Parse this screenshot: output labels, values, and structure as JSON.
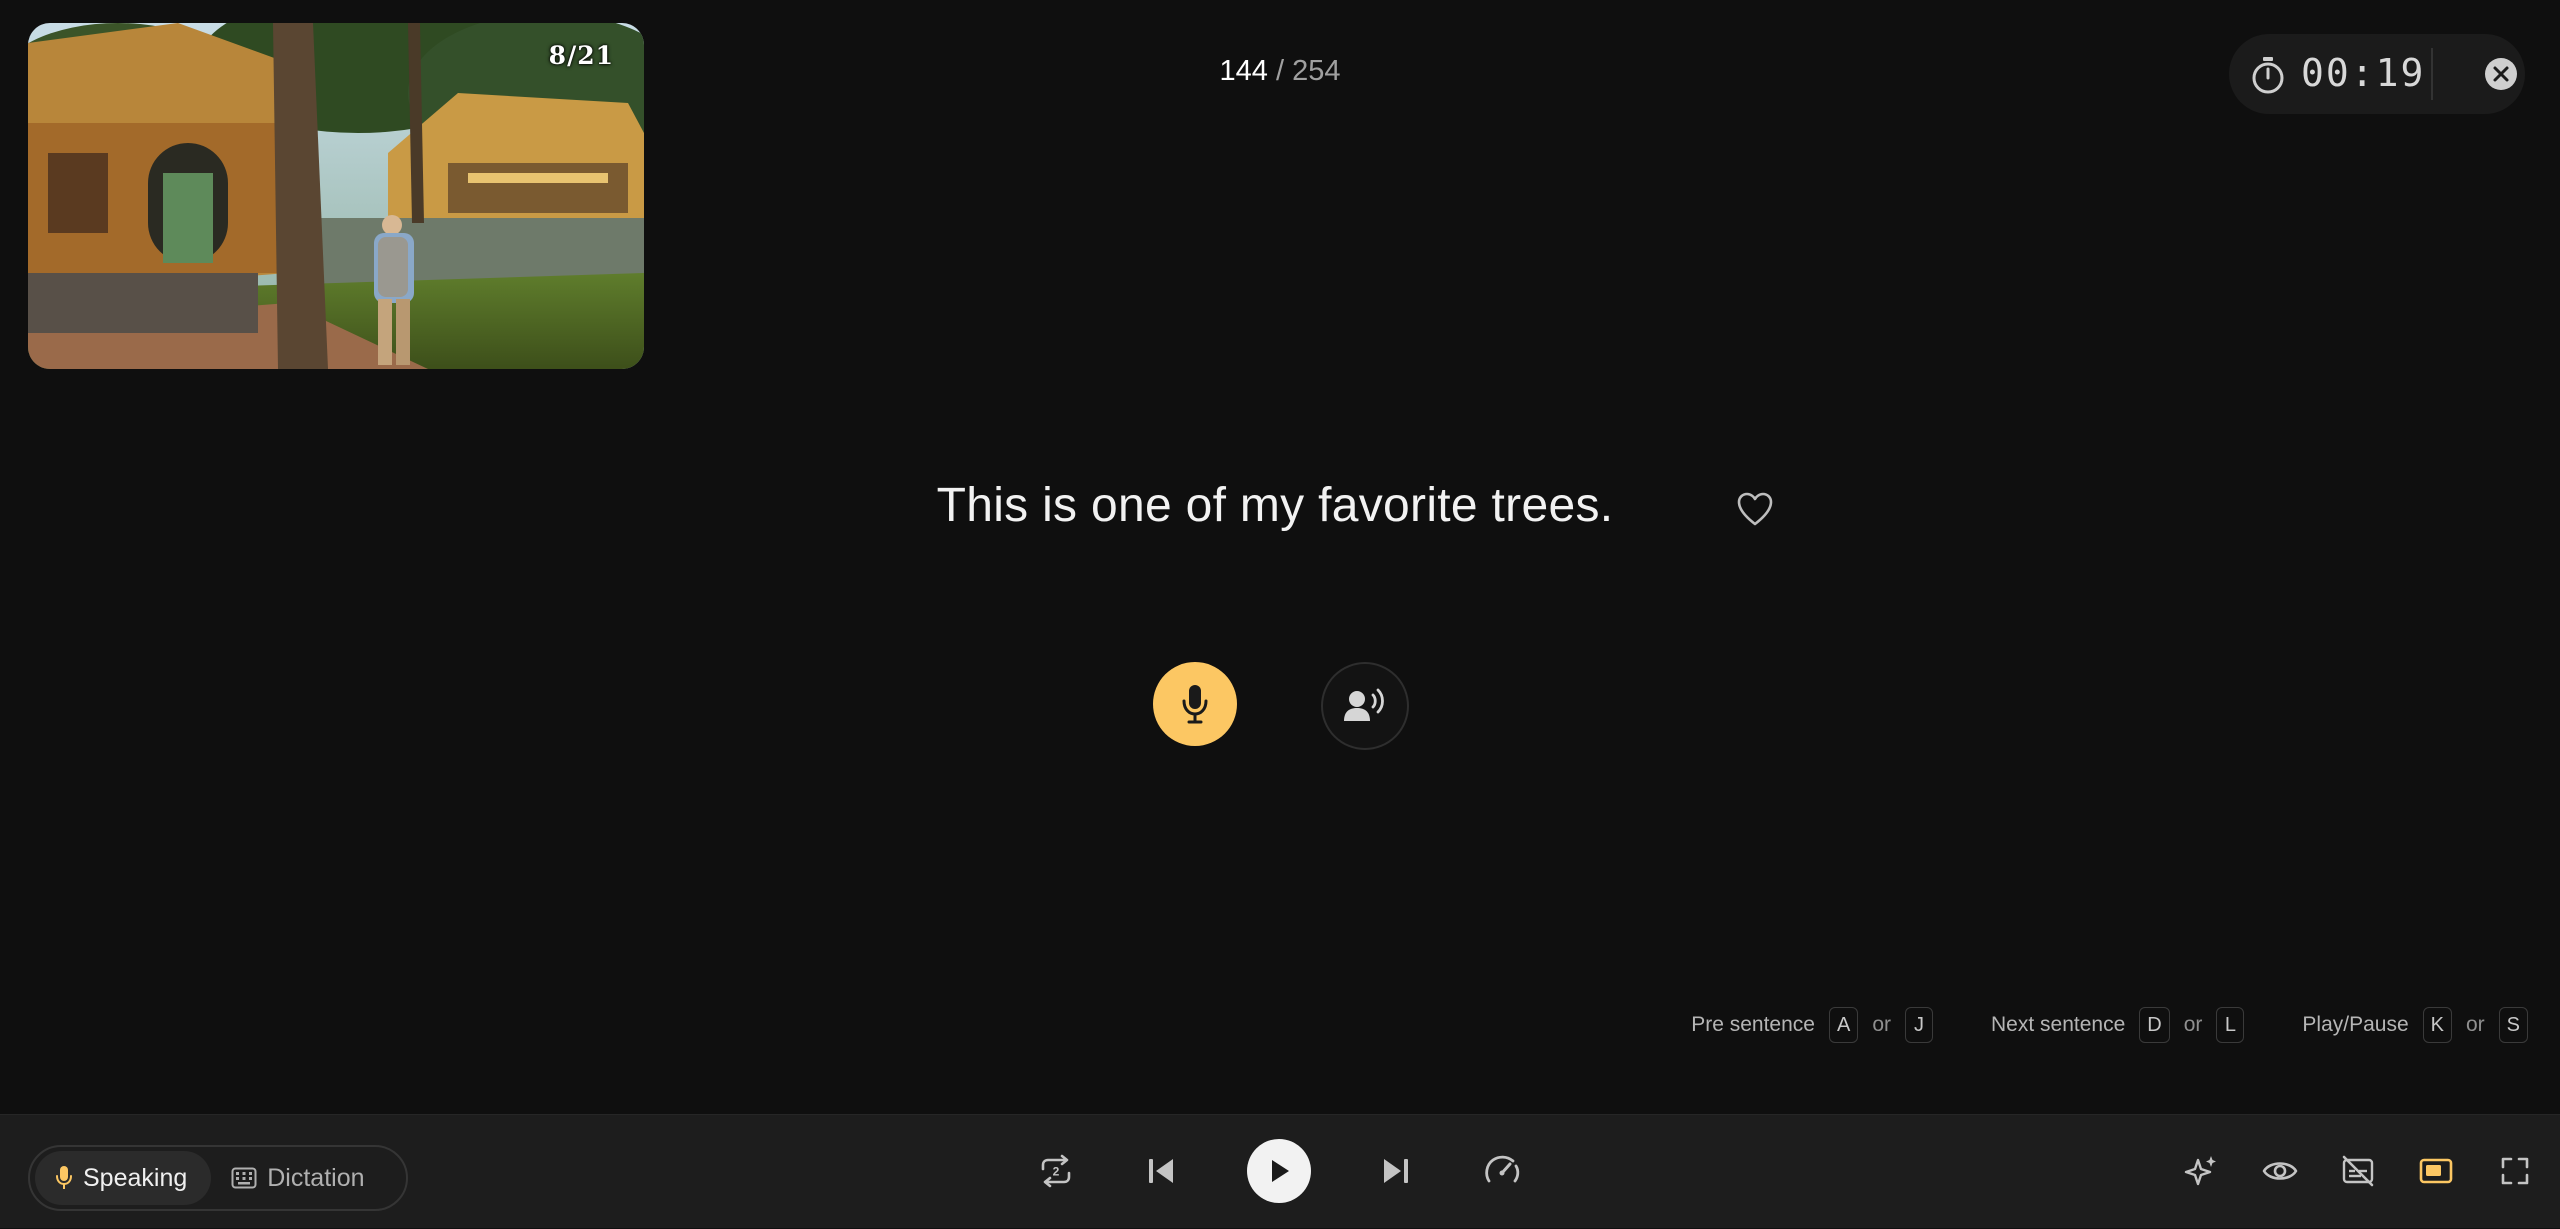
{
  "video": {
    "subtitle_counter": "8/21"
  },
  "progress": {
    "current": "144",
    "separator": " / ",
    "total": "254"
  },
  "timer": {
    "time": "00:19"
  },
  "sentence": {
    "text": "This is one of my favorite trees."
  },
  "shortcuts": [
    {
      "label": "Pre sentence",
      "key1": "A",
      "or": "or",
      "key2": "J"
    },
    {
      "label": "Next sentence",
      "key1": "D",
      "or": "or",
      "key2": "L"
    },
    {
      "label": "Play/Pause",
      "key1": "K",
      "or": "or",
      "key2": "S"
    }
  ],
  "modes": {
    "speaking": "Speaking",
    "dictation": "Dictation",
    "active": "speaking"
  },
  "controls": {
    "repeat_count": "2"
  },
  "colors": {
    "accent": "#fcc763",
    "background": "#0f0f0f",
    "bar": "#1d1d1d"
  },
  "icons": [
    "stopwatch-icon",
    "close-icon",
    "heart-icon",
    "microphone-icon",
    "listen-speaker-icon",
    "repeat-icon",
    "previous-icon",
    "play-icon",
    "next-icon",
    "speed-icon",
    "ai-sparkle-icon",
    "eye-icon",
    "subtitles-off-icon",
    "picture-in-picture-icon",
    "fullscreen-icon",
    "keyboard-icon"
  ]
}
